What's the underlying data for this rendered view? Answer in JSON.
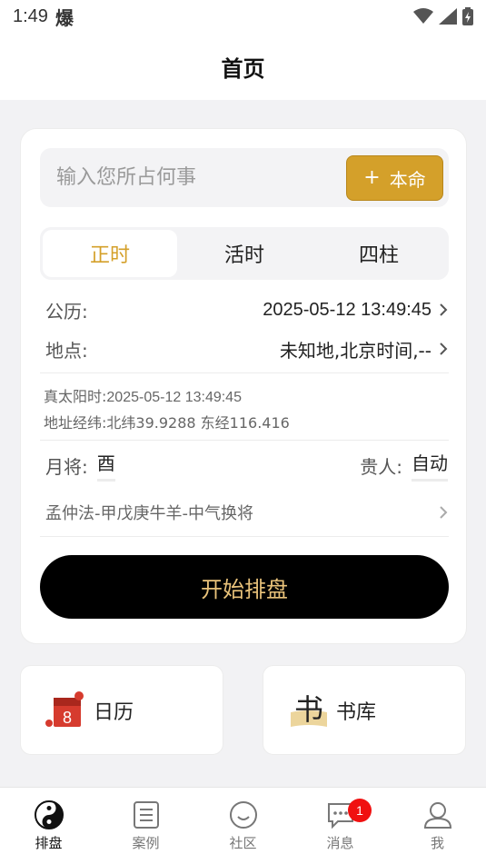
{
  "status_bar": {
    "time": "1:49",
    "extra": "爆"
  },
  "header": {
    "title": "首页"
  },
  "search": {
    "placeholder": "输入您所占何事",
    "button_label": "本命",
    "button_icon": "plus-icon"
  },
  "tabs": [
    {
      "label": "正时",
      "active": true
    },
    {
      "label": "活时",
      "active": false
    },
    {
      "label": "四柱",
      "active": false
    }
  ],
  "gongli": {
    "label": "公历:",
    "value": "2025-05-12 13:49:45"
  },
  "location": {
    "label": "地点:",
    "value": "未知地,北京时间,--"
  },
  "true_solar": {
    "label": "真太阳时:",
    "value": "2025-05-12 13:49:45"
  },
  "coords": {
    "label": "地址经纬:",
    "value": "北纬39.9288 东经116.416"
  },
  "yuejiang": {
    "label": "月将:",
    "value": "酉"
  },
  "guiren": {
    "label": "贵人:",
    "value": "自动"
  },
  "method": {
    "value": "孟仲法-甲戊庚牛羊-中气换将"
  },
  "start_button": {
    "label": "开始排盘"
  },
  "tiles": [
    {
      "label": "日历",
      "icon": "calendar-icon",
      "icon_text": "8"
    },
    {
      "label": "书库",
      "icon": "book-icon",
      "icon_text": "书"
    }
  ],
  "nav": [
    {
      "label": "排盘",
      "icon": "yin-yang-icon",
      "active": true
    },
    {
      "label": "案例",
      "icon": "document-icon",
      "active": false
    },
    {
      "label": "社区",
      "icon": "smile-icon",
      "active": false
    },
    {
      "label": "消息",
      "icon": "chat-icon",
      "active": false,
      "badge": "1"
    },
    {
      "label": "我",
      "icon": "user-icon",
      "active": false
    }
  ],
  "colors": {
    "accent": "#d4a02a",
    "start_text": "#e9c27a",
    "badge": "#f01010"
  }
}
